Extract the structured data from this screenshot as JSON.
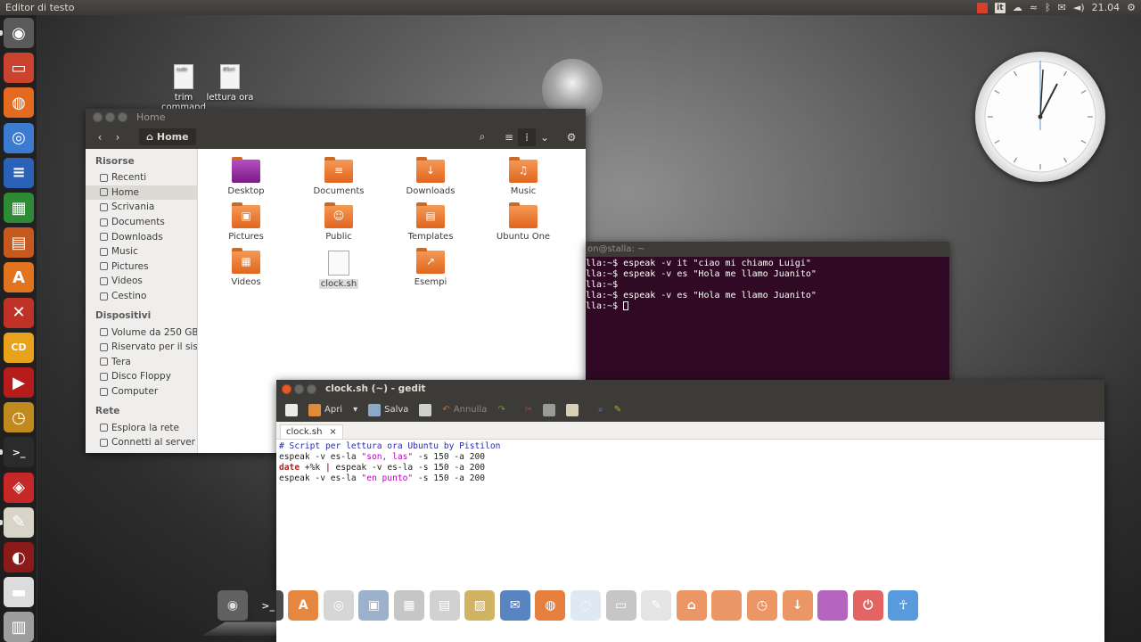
{
  "top_panel": {
    "app_title": "Editor di testo",
    "keyboard_layout": "it",
    "clock": "21.04",
    "icons": [
      "record-icon",
      "keyboard-icon",
      "cloud-icon",
      "wifi-icon",
      "bluetooth-icon",
      "mail-icon",
      "volume-icon",
      "gear-icon"
    ]
  },
  "desktop": {
    "icons": [
      {
        "label": "trim command",
        "preview": "sudo"
      },
      {
        "label": "lettura ora",
        "preview": "#Scri"
      }
    ]
  },
  "nautilus": {
    "title": "Home",
    "breadcrumb": "Home",
    "sidebar": {
      "sections": [
        {
          "heading": "Risorse",
          "items": [
            "Recenti",
            "Home",
            "Scrivania",
            "Documents",
            "Downloads",
            "Music",
            "Pictures",
            "Videos",
            "Cestino"
          ]
        },
        {
          "heading": "Dispositivi",
          "items": [
            "Volume da 250 GB",
            "Riservato per il sis...",
            "Tera",
            "Disco Floppy",
            "Computer"
          ]
        },
        {
          "heading": "Rete",
          "items": [
            "Esplora la rete",
            "Connetti al server"
          ]
        }
      ],
      "active": "Home"
    },
    "files": [
      {
        "name": "Desktop",
        "kind": "folder-purple",
        "glyph": ""
      },
      {
        "name": "Documents",
        "kind": "folder",
        "glyph": "≡"
      },
      {
        "name": "Downloads",
        "kind": "folder",
        "glyph": "↓"
      },
      {
        "name": "Music",
        "kind": "folder",
        "glyph": "♫"
      },
      {
        "name": "Pictures",
        "kind": "folder",
        "glyph": "▣"
      },
      {
        "name": "Public",
        "kind": "folder",
        "glyph": "☺"
      },
      {
        "name": "Templates",
        "kind": "folder",
        "glyph": "▤"
      },
      {
        "name": "Ubuntu One",
        "kind": "folder",
        "glyph": ""
      },
      {
        "name": "Videos",
        "kind": "folder",
        "glyph": "▦"
      },
      {
        "name": "clock.sh",
        "kind": "doc",
        "glyph": ""
      },
      {
        "name": "Esempi",
        "kind": "folder",
        "glyph": "↗"
      }
    ]
  },
  "terminal": {
    "title": "on@stalla: ~",
    "lines": [
      "lla:~$ espeak -v it \"ciao mi chiamo Luigi\"",
      "lla:~$ espeak -v es \"Hola me llamo Juanito\"",
      "lla:~$",
      "lla:~$ espeak -v es \"Hola me llamo Juanito\"",
      "lla:~$ "
    ]
  },
  "gedit": {
    "title": "clock.sh (~) - gedit",
    "toolbar": {
      "open_label": "Apri",
      "save_label": "Salva",
      "undo_label": "Annulla"
    },
    "tab": {
      "label": "clock.sh",
      "close": "×"
    },
    "code": [
      {
        "parts": [
          {
            "t": "# Script per lettura ora Ubuntu by Pistilon",
            "c": "comment"
          }
        ]
      },
      {
        "parts": [
          {
            "t": "espeak -v es-la ",
            "c": ""
          },
          {
            "t": "\"son, las\"",
            "c": "string"
          },
          {
            "t": " -s 150 -a 200",
            "c": ""
          }
        ]
      },
      {
        "parts": [
          {
            "t": "date",
            "c": "kw"
          },
          {
            "t": " +%k ",
            "c": ""
          },
          {
            "t": "|",
            "c": "kw"
          },
          {
            "t": " espeak -v es-la -s 150 -a 200",
            "c": ""
          }
        ]
      },
      {
        "parts": [
          {
            "t": "espeak -v es-la ",
            "c": ""
          },
          {
            "t": "\"en punto\"",
            "c": "string"
          },
          {
            "t": " -s 150 -a 200",
            "c": ""
          }
        ]
      }
    ]
  },
  "launcher": {
    "items": [
      {
        "name": "dash-icon",
        "color": "#5a5a5a",
        "glyph": "◉"
      },
      {
        "name": "files-icon",
        "color": "#c9432e",
        "glyph": "▭"
      },
      {
        "name": "firefox-icon",
        "color": "#e36a1e",
        "glyph": "◍"
      },
      {
        "name": "chromium-icon",
        "color": "#3d7bd1",
        "glyph": "◎"
      },
      {
        "name": "writer-icon",
        "color": "#2a62b8",
        "glyph": "≡"
      },
      {
        "name": "calc-icon",
        "color": "#2f8a36",
        "glyph": "▦"
      },
      {
        "name": "impress-icon",
        "color": "#c65a1e",
        "glyph": "▤"
      },
      {
        "name": "software-center-icon",
        "color": "#e2731f",
        "glyph": "A"
      },
      {
        "name": "settings-icon",
        "color": "#c03228",
        "glyph": "✕"
      },
      {
        "name": "cd-burner-icon",
        "color": "#e8a21c",
        "glyph": "CD"
      },
      {
        "name": "youtube-icon",
        "color": "#b71c1c",
        "glyph": "▶"
      },
      {
        "name": "clock-app-icon",
        "color": "#c08a1e",
        "glyph": "◷"
      },
      {
        "name": "terminal-icon",
        "color": "#2b2b2b",
        "glyph": ">_"
      },
      {
        "name": "lifesaver-icon",
        "color": "#c62828",
        "glyph": "◈"
      },
      {
        "name": "gedit-icon",
        "color": "#d8d4c8",
        "glyph": "✎"
      },
      {
        "name": "power-icon",
        "color": "#8b1a1a",
        "glyph": "◐"
      },
      {
        "name": "usb-drive-icon",
        "color": "#dcdcdc",
        "glyph": "▬"
      },
      {
        "name": "trash-icon",
        "color": "#9e9e9e",
        "glyph": "▥"
      }
    ]
  },
  "dock": {
    "items": [
      {
        "name": "dock-ubuntu-icon",
        "color": "#6b6b6b",
        "glyph": "◉"
      },
      {
        "name": "dock-terminal-icon",
        "color": "#2b2b2b",
        "glyph": ">_"
      },
      {
        "name": "dock-software-icon",
        "color": "#e2731f",
        "glyph": "A"
      },
      {
        "name": "dock-disk-icon",
        "color": "#cfcfcf",
        "glyph": "◎"
      },
      {
        "name": "dock-images-icon",
        "color": "#8aa4c4",
        "glyph": "▣"
      },
      {
        "name": "dock-calculator-icon",
        "color": "#bdbdbd",
        "glyph": "▦"
      },
      {
        "name": "dock-document-icon",
        "color": "#c9c9c9",
        "glyph": "▤"
      },
      {
        "name": "dock-photo-icon",
        "color": "#c9a64a",
        "glyph": "▨"
      },
      {
        "name": "dock-thunderbird-icon",
        "color": "#3d6fb8",
        "glyph": "✉"
      },
      {
        "name": "dock-firefox-icon",
        "color": "#e36a1e",
        "glyph": "◍"
      },
      {
        "name": "dock-chat-icon",
        "color": "#d9e6f2",
        "glyph": "◌"
      },
      {
        "name": "dock-drive-icon",
        "color": "#bdbdbd",
        "glyph": "▭"
      },
      {
        "name": "dock-editor-icon",
        "color": "#e0e0e0",
        "glyph": "✎"
      },
      {
        "name": "dock-folder-home-icon",
        "color": "#e8844a",
        "glyph": "⌂"
      },
      {
        "name": "dock-folder-icon",
        "color": "#e8844a",
        "glyph": ""
      },
      {
        "name": "dock-folder-recent-icon",
        "color": "#e8844a",
        "glyph": "◷"
      },
      {
        "name": "dock-folder-downloads-icon",
        "color": "#e8844a",
        "glyph": "↓"
      },
      {
        "name": "dock-folder-desktop-icon",
        "color": "#a84ab5",
        "glyph": ""
      },
      {
        "name": "dock-shutdown-icon",
        "color": "#e04848",
        "glyph": "⏻"
      },
      {
        "name": "dock-accessibility-icon",
        "color": "#3c8ad8",
        "glyph": "☥"
      }
    ]
  }
}
